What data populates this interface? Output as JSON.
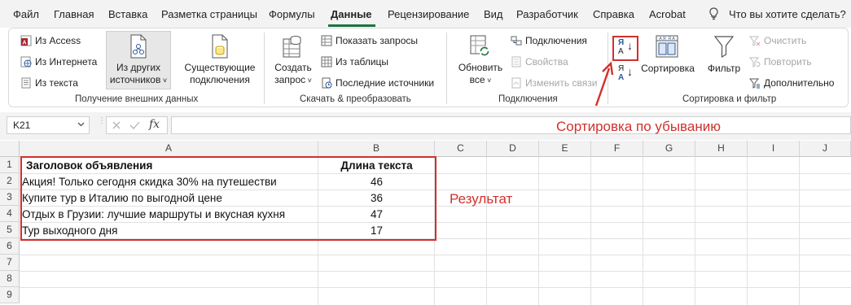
{
  "menu": {
    "items": [
      "Файл",
      "Главная",
      "Вставка",
      "Разметка страницы",
      "Формулы",
      "Данные",
      "Рецензирование",
      "Вид",
      "Разработчик",
      "Справка",
      "Acrobat"
    ],
    "search_placeholder": "Что вы хотите сделать?"
  },
  "ribbon": {
    "get_external": {
      "from_access": "Из Access",
      "from_web": "Из Интернета",
      "from_text": "Из текста",
      "from_other_1": "Из других",
      "from_other_2": "источников",
      "existing_1": "Существующие",
      "existing_2": "подключения",
      "group_label": "Получение внешних данных"
    },
    "transform": {
      "new_query_1": "Создать",
      "new_query_2": "запрос",
      "show_queries": "Показать запросы",
      "from_table": "Из таблицы",
      "recent_sources": "Последние источники",
      "group_label": "Скачать & преобразовать"
    },
    "connections": {
      "refresh_1": "Обновить",
      "refresh_2": "все",
      "connections": "Подключения",
      "properties": "Свойства",
      "edit_links": "Изменить связи",
      "group_label": "Подключения"
    },
    "sort_filter": {
      "sort_az_top": "А",
      "sort_az_bottom": "Я",
      "sort_za_top": "Я",
      "sort_za_bottom": "А",
      "sort": "Сортировка",
      "filter": "Фильтр",
      "clear": "Очистить",
      "reapply": "Повторить",
      "advanced": "Дополнительно",
      "group_label": "Сортировка и фильтр"
    }
  },
  "formula_bar": {
    "name_box": "K21",
    "fx": "fx",
    "formula": ""
  },
  "columns": [
    "A",
    "B",
    "C",
    "D",
    "E",
    "F",
    "G",
    "H",
    "I",
    "J"
  ],
  "rows": [
    "1",
    "2",
    "3",
    "4",
    "5",
    "6",
    "7",
    "8",
    "9"
  ],
  "table": {
    "header_a": "Заголовок объявления",
    "header_b": "Длина текста",
    "rows": [
      {
        "title": "Акция! Только сегодня скидка 30% на путешестви",
        "length": "46"
      },
      {
        "title": "Купите тур в Италию по выгодной цене",
        "length": "36"
      },
      {
        "title": "Отдых в Грузии: лучшие маршруты и вкусная кухня",
        "length": "47"
      },
      {
        "title": "Тур выходного дня",
        "length": "17"
      }
    ]
  },
  "annotations": {
    "sort_desc": "Сортировка по убыванию",
    "result": "Результат",
    "color": "#d0312d"
  },
  "colors": {
    "accent": "#1a7343"
  }
}
